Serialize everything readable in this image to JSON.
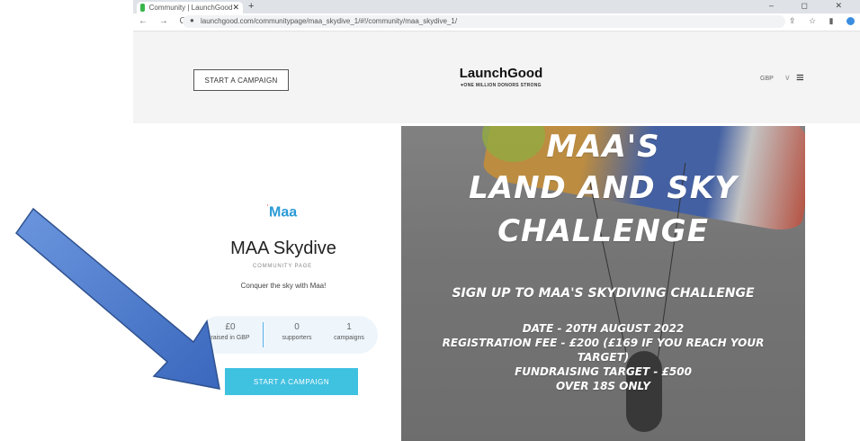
{
  "browser": {
    "tab_title": "Community | LaunchGood",
    "new_tab": "+",
    "url": "launchgood.com/communitypage/maa_skydive_1/#!/community/maa_skydive_1/",
    "nav_icons": "← → C",
    "window_controls": "– ◻ ✕"
  },
  "header": {
    "start_campaign_label": "START A CAMPAIGN",
    "logo": "LaunchGood",
    "tagline": "♥ONE MILLION DONORS STRONG",
    "currency": "GBP",
    "currency_chevron": "∨",
    "menu_icon": "≡"
  },
  "community": {
    "org_logo_text": "Maa",
    "title": "MAA Skydive",
    "subtitle": "COMMUNITY PAGE",
    "description": "Conquer the sky with Maa!",
    "stats": [
      {
        "value": "£0",
        "label": "raised in GBP"
      },
      {
        "value": "0",
        "label": "supporters"
      },
      {
        "value": "1",
        "label": "campaigns"
      }
    ],
    "cta_label": "START A CAMPAIGN"
  },
  "hero": {
    "line1": "MAA'S",
    "line2": "LAND AND SKY",
    "line3": "CHALLENGE",
    "signup": "SIGN UP TO MAA'S SKYDIVING CHALLENGE",
    "date": "DATE - 20TH AUGUST 2022",
    "fee1": "REGISTRATION FEE - £200 (£169 IF YOU REACH YOUR",
    "fee2": "TARGET)",
    "target": "FUNDRAISING TARGET - £500",
    "age": "OVER 18S ONLY"
  },
  "colors": {
    "arrow": "#4472c4",
    "cta": "#3fc1e0",
    "stats_bg": "#eef6fc"
  }
}
